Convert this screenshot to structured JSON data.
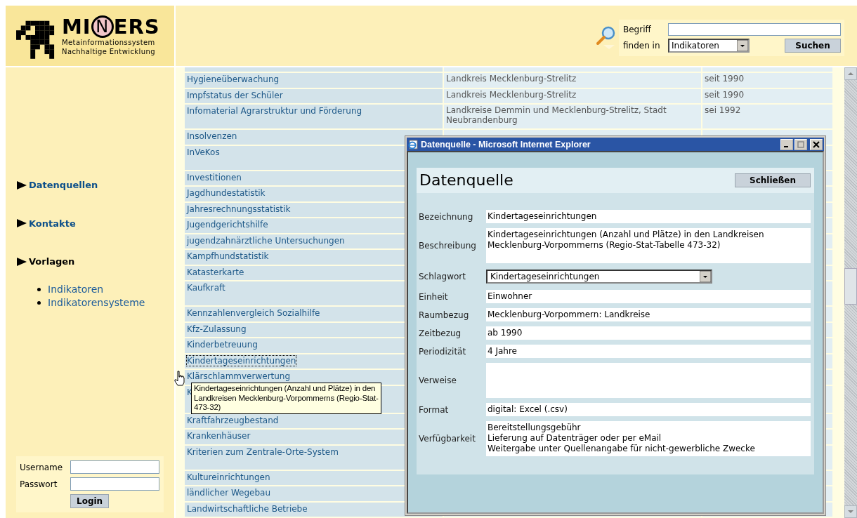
{
  "logo": {
    "parts": [
      {
        "text": "MI",
        "circled": false
      },
      {
        "text": "N",
        "circled": true
      },
      {
        "text": "ERS",
        "circled": false
      }
    ],
    "subtitle_lines": [
      "Metainformationssystem",
      "Nachhaltige Entwicklung"
    ]
  },
  "search": {
    "term_label": "Begriff",
    "scope_label": "finden in",
    "scope_value": "Indikatoren",
    "button": "Suchen"
  },
  "sidebar": {
    "sections": [
      {
        "label": "Datenquellen",
        "selected": false
      },
      {
        "label": "Kontakte",
        "selected": false
      },
      {
        "label": "Vorlagen",
        "selected": true,
        "children": [
          {
            "label": "Indikatoren"
          },
          {
            "label": "Indikatorensysteme"
          }
        ]
      }
    ]
  },
  "login": {
    "username_label": "Username",
    "password_label": "Passwort",
    "button": "Login"
  },
  "table": {
    "rows": [
      {
        "name": "Hygieneüberwachung",
        "region": "Landkreis Mecklenburg-Strelitz",
        "period": "seit 1990",
        "tall": false
      },
      {
        "name": "Impfstatus der Schüler",
        "region": "Landkreis Mecklenburg-Strelitz",
        "period": "seit 1990",
        "tall": false
      },
      {
        "name": "Infomaterial Agrarstruktur und Förderung",
        "region": "Landkreise Demmin und Mecklenburg-Strelitz, Stadt Neubrandenburg",
        "period": "sei 1992",
        "tall": true
      },
      {
        "name": "Insolvenzen",
        "tall": false
      },
      {
        "name": "InVeKos",
        "tall": true
      },
      {
        "name": "Investitionen",
        "tall": false
      },
      {
        "name": "Jagdhundestatistik",
        "tall": false
      },
      {
        "name": "Jahresrechnungsstatistik",
        "tall": false
      },
      {
        "name": "Jugendgerichtshilfe",
        "tall": false
      },
      {
        "name": "jugendzahnärztliche Untersuchungen",
        "tall": false
      },
      {
        "name": "Kampfhundstatistik",
        "tall": false
      },
      {
        "name": "Katasterkarte",
        "tall": false
      },
      {
        "name": "Kaufkraft",
        "tall": true
      },
      {
        "name": "Kennzahlenvergleich Sozialhilfe",
        "tall": false
      },
      {
        "name": "Kfz-Zulassung",
        "tall": false
      },
      {
        "name": "Kinderbetreuung",
        "tall": false
      },
      {
        "name": "Kindertageseinrichtungen",
        "tall": false,
        "focused": true
      },
      {
        "name": "Klärschlammverwertung",
        "tall": false
      },
      {
        "name": "K",
        "tall": true
      },
      {
        "name": "Kraftfahrzeugbestand",
        "tall": false
      },
      {
        "name": "Krankenhäuser",
        "tall": false
      },
      {
        "name": "Kriterien zum Zentrale-Orte-System",
        "tall": true
      },
      {
        "name": "Kultureinrichtungen",
        "tall": false
      },
      {
        "name": "ländlicher Wegebau",
        "tall": false
      },
      {
        "name": "Landwirtschaftliche Betriebe",
        "tall": false
      }
    ]
  },
  "tooltip": {
    "lines": [
      "Kindertageseinrichtungen (Anzahl und Plätze) in den",
      "Landkreisen Mecklenburg-Vorpommerns (Regio-Stat-",
      "473-32)"
    ]
  },
  "popup": {
    "window_title": "Datenquelle - Microsoft Internet Explorer",
    "heading": "Datenquelle",
    "close_button": "Schließen",
    "fields": [
      {
        "label": "Bezeichnung",
        "kind": "text",
        "value": "Kindertageseinrichtungen"
      },
      {
        "label": "Beschreibung",
        "kind": "area",
        "value": "Kindertageseinrichtungen (Anzahl und Plätze) in den Landkreisen\nMecklenburg-Vorpommerns (Regio-Stat-Tabelle 473-32)"
      },
      {
        "label": "Schlagwort",
        "kind": "select",
        "value": "Kindertageseinrichtungen"
      },
      {
        "label": "Einheit",
        "kind": "text",
        "value": "Einwohner"
      },
      {
        "label": "Raumbezug",
        "kind": "text",
        "value": "Mecklenburg-Vorpommern: Landkreise"
      },
      {
        "label": "Zeitbezug",
        "kind": "text",
        "value": "ab 1990"
      },
      {
        "label": "Periodizität",
        "kind": "text",
        "value": "4 Jahre"
      },
      {
        "label": "Verweise",
        "kind": "area"
      },
      {
        "label": "Format",
        "kind": "text",
        "value": "digital: Excel (.csv)"
      },
      {
        "label": "Verfügbarkeit",
        "kind": "area",
        "value": "Bereitstellungsgebühr\nLieferung auf Datenträger oder per eMail\nWeitergabe unter Quellenangabe für nicht-gewerbliche Zwecke"
      }
    ]
  }
}
